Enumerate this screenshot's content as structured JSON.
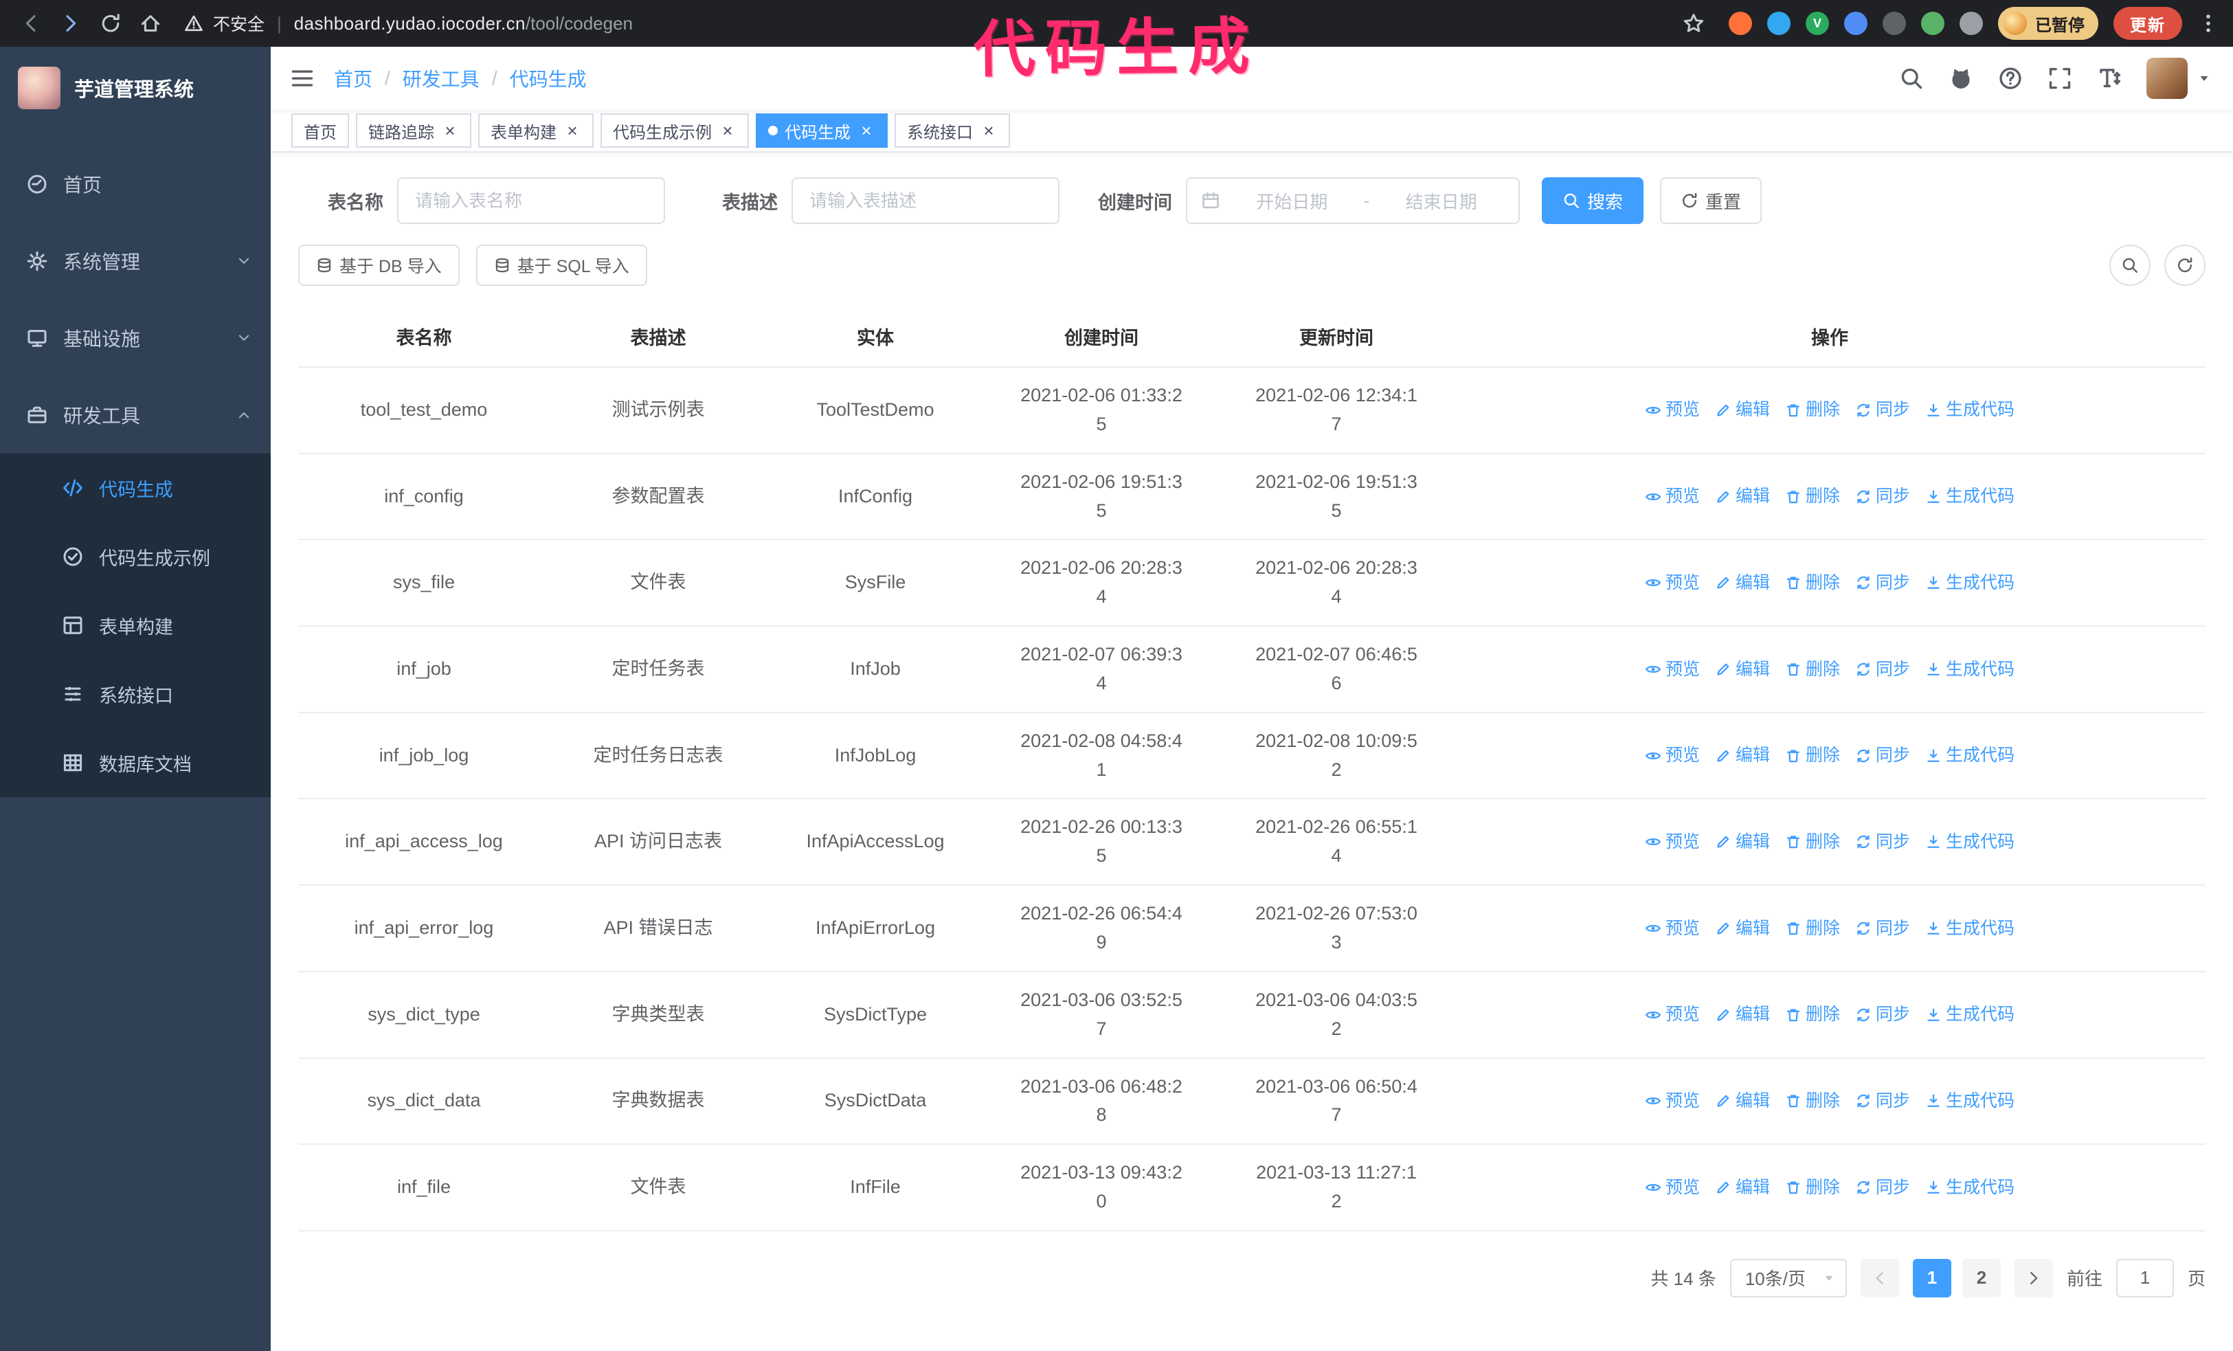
{
  "browser": {
    "security_label": "不安全",
    "url_host": "dashboard.yudao.iocoder.cn",
    "url_path": "/tool/codegen",
    "extensions": [
      {
        "key": "fox",
        "color": "#ff7139"
      },
      {
        "key": "drop",
        "color": "#31a8f0"
      },
      {
        "key": "check",
        "color": "#2bab5e",
        "glyph": "V"
      },
      {
        "key": "people",
        "color": "#4f8df5"
      },
      {
        "key": "box",
        "color": "#5f6368"
      },
      {
        "key": "leaf",
        "color": "#58b368"
      },
      {
        "key": "puzzle",
        "color": "#9aa0a6"
      }
    ],
    "paused_badge": "已暂停",
    "update_button": "更新"
  },
  "annotation": {
    "text": "代码生成",
    "color": "#ff2b6d"
  },
  "sidebar": {
    "logo_title": "芋道管理系统",
    "items": [
      {
        "key": "home",
        "label": "首页",
        "icon": "dashboard"
      },
      {
        "key": "system",
        "label": "系统管理",
        "icon": "gear",
        "expandable": true
      },
      {
        "key": "infra",
        "label": "基础设施",
        "icon": "infra",
        "expandable": true
      },
      {
        "key": "devtools",
        "label": "研发工具",
        "icon": "toolbox",
        "expandable": true,
        "expanded": true,
        "children": [
          {
            "key": "codegen",
            "label": "代码生成",
            "icon": "code",
            "active": true
          },
          {
            "key": "codegen-example",
            "label": "代码生成示例",
            "icon": "example"
          },
          {
            "key": "form-builder",
            "label": "表单构建",
            "icon": "form"
          },
          {
            "key": "system-api",
            "label": "系统接口",
            "icon": "api"
          },
          {
            "key": "db-doc",
            "label": "数据库文档",
            "icon": "dbdoc"
          }
        ]
      }
    ]
  },
  "header": {
    "breadcrumb": [
      "首页",
      "研发工具",
      "代码生成"
    ],
    "icons": [
      "search",
      "github",
      "question",
      "fullscreen",
      "font-size"
    ]
  },
  "tabs": [
    {
      "key": "home",
      "label": "首页"
    },
    {
      "key": "tracer",
      "label": "链路追踪",
      "closable": true
    },
    {
      "key": "form-builder",
      "label": "表单构建",
      "closable": true
    },
    {
      "key": "codegen-example",
      "label": "代码生成示例",
      "closable": true
    },
    {
      "key": "codegen",
      "label": "代码生成",
      "closable": true,
      "active": true
    },
    {
      "key": "system-api",
      "label": "系统接口",
      "closable": true
    }
  ],
  "filters": {
    "table_name_label": "表名称",
    "table_name_placeholder": "请输入表名称",
    "table_desc_label": "表描述",
    "table_desc_placeholder": "请输入表描述",
    "create_time_label": "创建时间",
    "date_start_placeholder": "开始日期",
    "date_separator": "-",
    "date_end_placeholder": "结束日期",
    "search_button": "搜索",
    "reset_button": "重置"
  },
  "toolbar": {
    "import_db": "基于 DB 导入",
    "import_sql": "基于 SQL 导入"
  },
  "table": {
    "columns": [
      "表名称",
      "表描述",
      "实体",
      "创建时间",
      "更新时间",
      "操作"
    ],
    "actions": [
      {
        "key": "preview",
        "label": "预览",
        "icon": "eye"
      },
      {
        "key": "edit",
        "label": "编辑",
        "icon": "edit"
      },
      {
        "key": "delete",
        "label": "删除",
        "icon": "trash"
      },
      {
        "key": "sync",
        "label": "同步",
        "icon": "sync"
      },
      {
        "key": "generate",
        "label": "生成代码",
        "icon": "download"
      }
    ],
    "rows": [
      {
        "name": "tool_test_demo",
        "desc": "测试示例表",
        "entity": "ToolTestDemo",
        "created": "2021-02-06 01:33:25",
        "updated": "2021-02-06 12:34:17"
      },
      {
        "name": "inf_config",
        "desc": "参数配置表",
        "entity": "InfConfig",
        "created": "2021-02-06 19:51:35",
        "updated": "2021-02-06 19:51:35"
      },
      {
        "name": "sys_file",
        "desc": "文件表",
        "entity": "SysFile",
        "created": "2021-02-06 20:28:34",
        "updated": "2021-02-06 20:28:34"
      },
      {
        "name": "inf_job",
        "desc": "定时任务表",
        "entity": "InfJob",
        "created": "2021-02-07 06:39:34",
        "updated": "2021-02-07 06:46:56"
      },
      {
        "name": "inf_job_log",
        "desc": "定时任务日志表",
        "entity": "InfJobLog",
        "created": "2021-02-08 04:58:41",
        "updated": "2021-02-08 10:09:52"
      },
      {
        "name": "inf_api_access_log",
        "desc": "API 访问日志表",
        "entity": "InfApiAccessLog",
        "created": "2021-02-26 00:13:35",
        "updated": "2021-02-26 06:55:14"
      },
      {
        "name": "inf_api_error_log",
        "desc": "API 错误日志",
        "entity": "InfApiErrorLog",
        "created": "2021-02-26 06:54:49",
        "updated": "2021-02-26 07:53:03"
      },
      {
        "name": "sys_dict_type",
        "desc": "字典类型表",
        "entity": "SysDictType",
        "created": "2021-03-06 03:52:57",
        "updated": "2021-03-06 04:03:52"
      },
      {
        "name": "sys_dict_data",
        "desc": "字典数据表",
        "entity": "SysDictData",
        "created": "2021-03-06 06:48:28",
        "updated": "2021-03-06 06:50:47"
      },
      {
        "name": "inf_file",
        "desc": "文件表",
        "entity": "InfFile",
        "created": "2021-03-13 09:43:20",
        "updated": "2021-03-13 11:27:12"
      }
    ]
  },
  "pagination": {
    "total_text": "共 14 条",
    "page_size": "10条/页",
    "pages": [
      {
        "label": "1",
        "active": true
      },
      {
        "label": "2"
      }
    ],
    "goto_label": "前往",
    "goto_value": "1",
    "goto_suffix": "页"
  }
}
